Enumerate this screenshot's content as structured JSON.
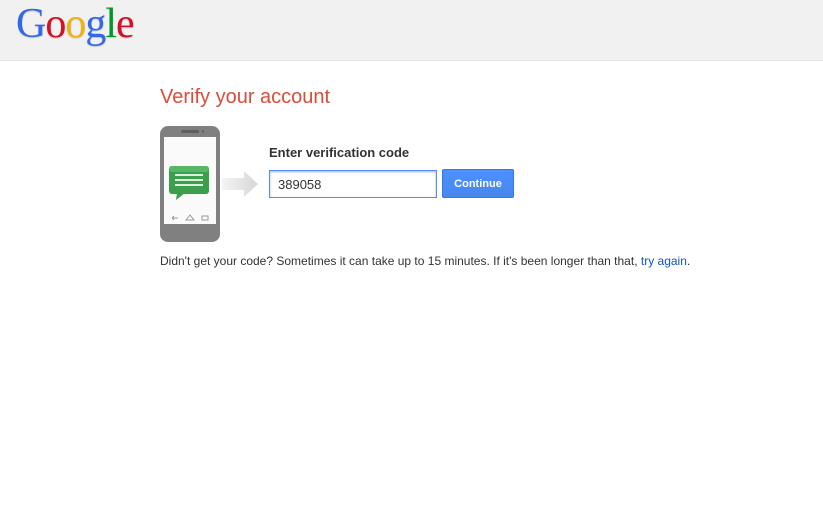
{
  "header": {
    "logo_letters": [
      {
        "char": "G",
        "color": "#3369e8"
      },
      {
        "char": "o",
        "color": "#d50f25"
      },
      {
        "char": "o",
        "color": "#eeb211"
      },
      {
        "char": "g",
        "color": "#3369e8"
      },
      {
        "char": "l",
        "color": "#009925"
      },
      {
        "char": "e",
        "color": "#d50f25"
      }
    ]
  },
  "main": {
    "title": "Verify your account",
    "illustration": {
      "phone_icon": "smartphone-icon",
      "message_icon": "chat-bubble-icon",
      "arrow_icon": "arrow-right-icon"
    },
    "field_label": "Enter verification code",
    "code_value": "389058",
    "continue_label": "Continue",
    "help_text": "Didn't get your code? Sometimes it can take up to 15 minutes. If it's been longer than that, ",
    "try_again_label": "try again",
    "help_suffix": "."
  },
  "colors": {
    "title": "#dd4b39",
    "link": "#1155cc",
    "button": "#4d90fe",
    "message_green": "#3c9f4c"
  }
}
